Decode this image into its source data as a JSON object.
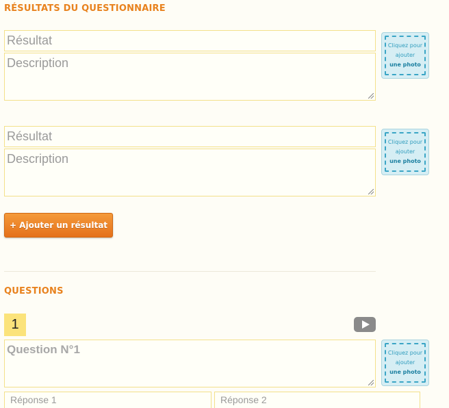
{
  "results_section": {
    "title": "RÉSULTATS DU QUESTIONNAIRE",
    "items": [
      {
        "result_placeholder": "Résultat",
        "description_placeholder": "Description"
      },
      {
        "result_placeholder": "Résultat",
        "description_placeholder": "Description"
      }
    ],
    "add_button_label": "+ Ajouter un résultat"
  },
  "photo_upload": {
    "line1": "Cliquez pour",
    "line2": "ajouter",
    "line3": "une photo"
  },
  "questions_section": {
    "title": "QUESTIONS",
    "question": {
      "number": "1",
      "placeholder": "Question N°1",
      "answers": [
        "Réponse 1",
        "Réponse 2"
      ],
      "video_icon": "play-icon"
    }
  },
  "colors": {
    "accent": "#e8821e",
    "field_border": "#f3e08a",
    "photo_bg": "#d6eef4",
    "number_bg": "#fbe37b"
  }
}
